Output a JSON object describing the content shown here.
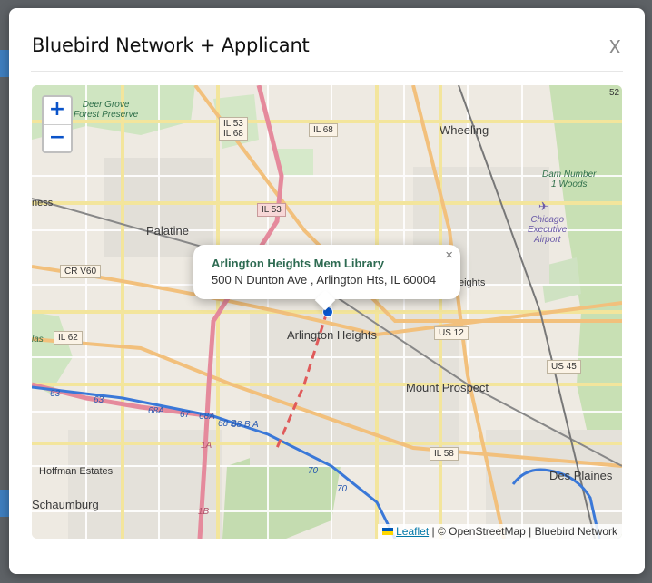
{
  "modal": {
    "title": "Bluebird Network + Applicant",
    "close_label": "X"
  },
  "map": {
    "zoom_in": "+",
    "zoom_out": "−",
    "popup": {
      "name": "Arlington Heights Mem Library",
      "address": "500 N Dunton Ave , Arlington Hts, IL 60004",
      "close": "×"
    },
    "attribution": {
      "leaflet": "Leaflet",
      "rest": " | © OpenStreetMap | Bluebird Network"
    },
    "places": {
      "wheeling": "Wheeling",
      "palatine": "Palatine",
      "arlington": "Arlington Heights",
      "mount_prospect": "Mount Prospect",
      "des_plaines": "Des Plaines",
      "hoffman": "Hoffman Estates",
      "schaumburg": "Schaumburg",
      "heights_partial": "eights",
      "ness_partial": "ness",
      "las_partial": "las"
    },
    "parks": {
      "deer_grove": "Deer Grove\nForest Preserve",
      "dam_woods": "Dam Number\n1 Woods"
    },
    "airport": "Chicago\nExecutive\nAirport",
    "shields": {
      "il53_68": "IL 53\nIL 68",
      "il68": "IL 68",
      "il53": "IL 53",
      "crv60": "CR V60",
      "il62": "IL 62",
      "us12": "US 12",
      "us45": "US 45",
      "il58": "IL 58",
      "r52": "52"
    },
    "route_labels": {
      "r63a": "63",
      "r63b": "63",
      "r68a": "68A",
      "r67": "67",
      "r68a2": "68A",
      "r68b": "68 B",
      "r68ba": "68 B A",
      "r1a": "1A",
      "r1b": "1B",
      "r70": "70",
      "r70b": "70"
    }
  }
}
